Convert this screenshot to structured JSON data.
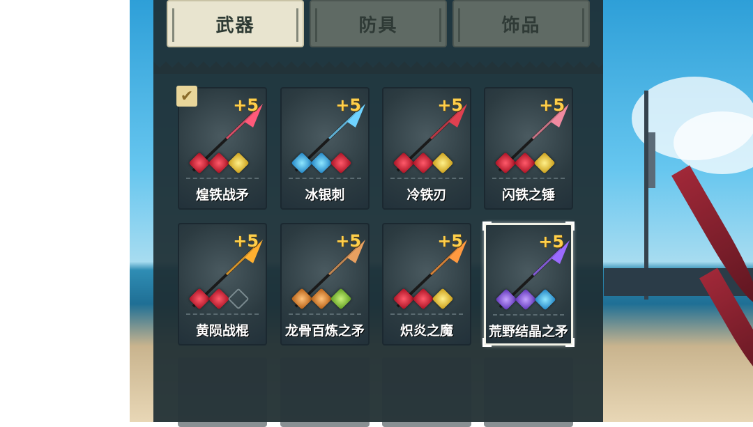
{
  "tabs": [
    {
      "label": "武器",
      "active": true
    },
    {
      "label": "防具",
      "active": false
    },
    {
      "label": "饰品",
      "active": false
    }
  ],
  "items": [
    {
      "name": "煌铁战矛",
      "plus": "+5",
      "gems": [
        "red",
        "red",
        "yellow"
      ],
      "equipped": true,
      "selected": false,
      "weapon_color": "#ff5a7a"
    },
    {
      "name": "冰银刺",
      "plus": "+5",
      "gems": [
        "blue",
        "blue",
        "red"
      ],
      "equipped": false,
      "selected": false,
      "weapon_color": "#6fd3ff"
    },
    {
      "name": "冷铁刃",
      "plus": "+5",
      "gems": [
        "red",
        "red",
        "yellow"
      ],
      "equipped": false,
      "selected": false,
      "weapon_color": "#e04050"
    },
    {
      "name": "闪铁之锤",
      "plus": "+5",
      "gems": [
        "red",
        "red",
        "yellow"
      ],
      "equipped": false,
      "selected": false,
      "weapon_color": "#f08aa0"
    },
    {
      "name": "黄陨战棍",
      "plus": "+5",
      "gems": [
        "red",
        "red",
        "empty"
      ],
      "equipped": false,
      "selected": false,
      "weapon_color": "#ffb030"
    },
    {
      "name": "龙骨百炼之矛",
      "plus": "+5",
      "gems": [
        "orange",
        "orange",
        "green"
      ],
      "equipped": false,
      "selected": false,
      "weapon_color": "#e8a060"
    },
    {
      "name": "炽炎之魔",
      "plus": "+5",
      "gems": [
        "red",
        "red",
        "yellow"
      ],
      "equipped": false,
      "selected": false,
      "weapon_color": "#ff9a40"
    },
    {
      "name": "荒野结晶之矛",
      "plus": "+5",
      "gems": [
        "purple",
        "purple",
        "blue"
      ],
      "equipped": false,
      "selected": true,
      "weapon_color": "#9a6aff"
    }
  ],
  "icons": {
    "equipped": "checkmark-icon"
  }
}
